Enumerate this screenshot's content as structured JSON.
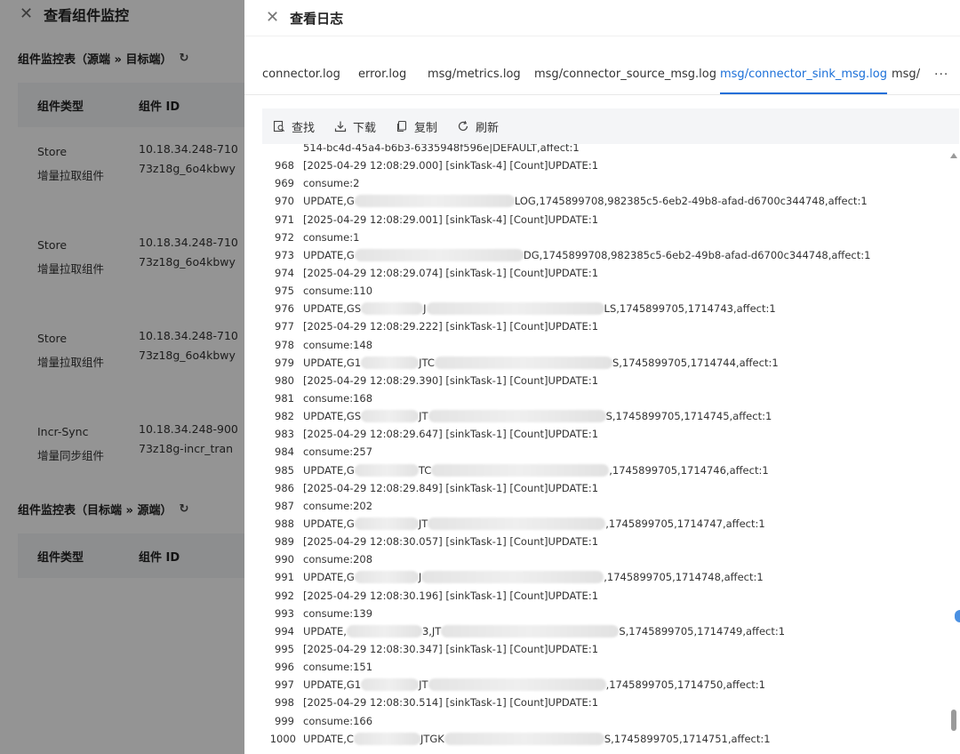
{
  "background_drawer": {
    "title": "查看组件监控",
    "section1_title": "组件监控表（源端 » 目标端）",
    "section2_title": "组件监控表（目标端 » 源端）",
    "col_type": "组件类型",
    "col_id": "组件 ID",
    "rows": [
      {
        "type": "Store",
        "type_cn": "增量拉取组件",
        "id1": "10.18.34.248-710",
        "id2": "73z18g_6o4kbwy"
      },
      {
        "type": "Store",
        "type_cn": "增量拉取组件",
        "id1": "10.18.34.248-710",
        "id2": "73z18g_6o4kbwy"
      },
      {
        "type": "Store",
        "type_cn": "增量拉取组件",
        "id1": "10.18.34.248-710",
        "id2": "73z18g_6o4kbwy"
      },
      {
        "type": "Incr-Sync",
        "type_cn": "增量同步组件",
        "id1": "10.18.34.248-900",
        "id2": "73z18g-incr_tran"
      }
    ]
  },
  "drawer": {
    "title": "查看日志",
    "tabs": [
      "connector.log",
      "error.log",
      "msg/metrics.log",
      "msg/connector_source_msg.log",
      "msg/connector_sink_msg.log",
      "msg/c"
    ],
    "active_tab": "msg/connector_sink_msg.log",
    "more_label": "···",
    "toolbar": {
      "find": "查找",
      "download": "下载",
      "copy": "复制",
      "refresh": "刷新"
    }
  },
  "log": {
    "first_partial": "514-bc4d-45a4-b6b3-6335948f596e|DEFAULT,affect:1",
    "lines": [
      {
        "n": "968",
        "a": "[2025-04-29 12:08:29.000] [sinkTask-4] [Count]UPDATE:1"
      },
      {
        "n": "969",
        "a": "consume:2"
      },
      {
        "n": "970",
        "a": "UPDATE,G",
        "b": "LOG,1745899708,982385c5-6eb2-49b8-afad-d6700c344748,affect:1",
        "blur": [
          180
        ]
      },
      {
        "n": "971",
        "a": "[2025-04-29 12:08:29.001] [sinkTask-4] [Count]UPDATE:1"
      },
      {
        "n": "972",
        "a": "consume:1"
      },
      {
        "n": "973",
        "a": "UPDATE,G",
        "b": "DG,1745899708,982385c5-6eb2-49b8-afad-d6700c344748,affect:1",
        "blur": [
          190
        ]
      },
      {
        "n": "974",
        "a": "[2025-04-29 12:08:29.074] [sinkTask-1] [Count]UPDATE:1"
      },
      {
        "n": "975",
        "a": "consume:110"
      },
      {
        "n": "976",
        "a": "UPDATE,GS",
        "m": "J",
        "b": "LS,1745899705,1714743,affect:1",
        "blur": [
          70,
          200
        ]
      },
      {
        "n": "977",
        "a": "[2025-04-29 12:08:29.222] [sinkTask-1] [Count]UPDATE:1"
      },
      {
        "n": "978",
        "a": "consume:148"
      },
      {
        "n": "979",
        "a": "UPDATE,G1",
        "m": "JTC",
        "b": "S,1745899705,1714744,affect:1",
        "blur": [
          65,
          200
        ]
      },
      {
        "n": "980",
        "a": "[2025-04-29 12:08:29.390] [sinkTask-1] [Count]UPDATE:1"
      },
      {
        "n": "981",
        "a": "consume:168"
      },
      {
        "n": "982",
        "a": "UPDATE,GS",
        "m": "JT",
        "b": "S,1745899705,1714745,affect:1",
        "blur": [
          65,
          200
        ]
      },
      {
        "n": "983",
        "a": "[2025-04-29 12:08:29.647] [sinkTask-1] [Count]UPDATE:1"
      },
      {
        "n": "984",
        "a": "consume:257"
      },
      {
        "n": "985",
        "a": "UPDATE,G",
        "m": "TC",
        "b": ",1745899705,1714746,affect:1",
        "blur": [
          72,
          200
        ]
      },
      {
        "n": "986",
        "a": "[2025-04-29 12:08:29.849] [sinkTask-1] [Count]UPDATE:1"
      },
      {
        "n": "987",
        "a": "consume:202"
      },
      {
        "n": "988",
        "a": "UPDATE,G",
        "m": "JT",
        "b": ",1745899705,1714747,affect:1",
        "blur": [
          72,
          200
        ]
      },
      {
        "n": "989",
        "a": "[2025-04-29 12:08:30.057] [sinkTask-1] [Count]UPDATE:1"
      },
      {
        "n": "990",
        "a": "consume:208"
      },
      {
        "n": "991",
        "a": "UPDATE,G",
        "m": "J",
        "b": ",1745899705,1714748,affect:1",
        "blur": [
          72,
          205
        ]
      },
      {
        "n": "992",
        "a": "[2025-04-29 12:08:30.196] [sinkTask-1] [Count]UPDATE:1"
      },
      {
        "n": "993",
        "a": "consume:139"
      },
      {
        "n": "994",
        "a": "UPDATE,",
        "m": "3,JT",
        "b": "S,1745899705,1714749,affect:1",
        "blur": [
          85,
          200
        ]
      },
      {
        "n": "995",
        "a": "[2025-04-29 12:08:30.347] [sinkTask-1] [Count]UPDATE:1"
      },
      {
        "n": "996",
        "a": "consume:151"
      },
      {
        "n": "997",
        "a": "UPDATE,G1",
        "m": "JT",
        "b": ",1745899705,1714750,affect:1",
        "blur": [
          65,
          200
        ]
      },
      {
        "n": "998",
        "a": "[2025-04-29 12:08:30.514] [sinkTask-1] [Count]UPDATE:1"
      },
      {
        "n": "999",
        "a": "consume:166"
      },
      {
        "n": "1000",
        "a": "UPDATE,C",
        "m": "JTGK",
        "b": "S,1745899705,1714751,affect:1",
        "blur": [
          75,
          180
        ]
      }
    ]
  }
}
